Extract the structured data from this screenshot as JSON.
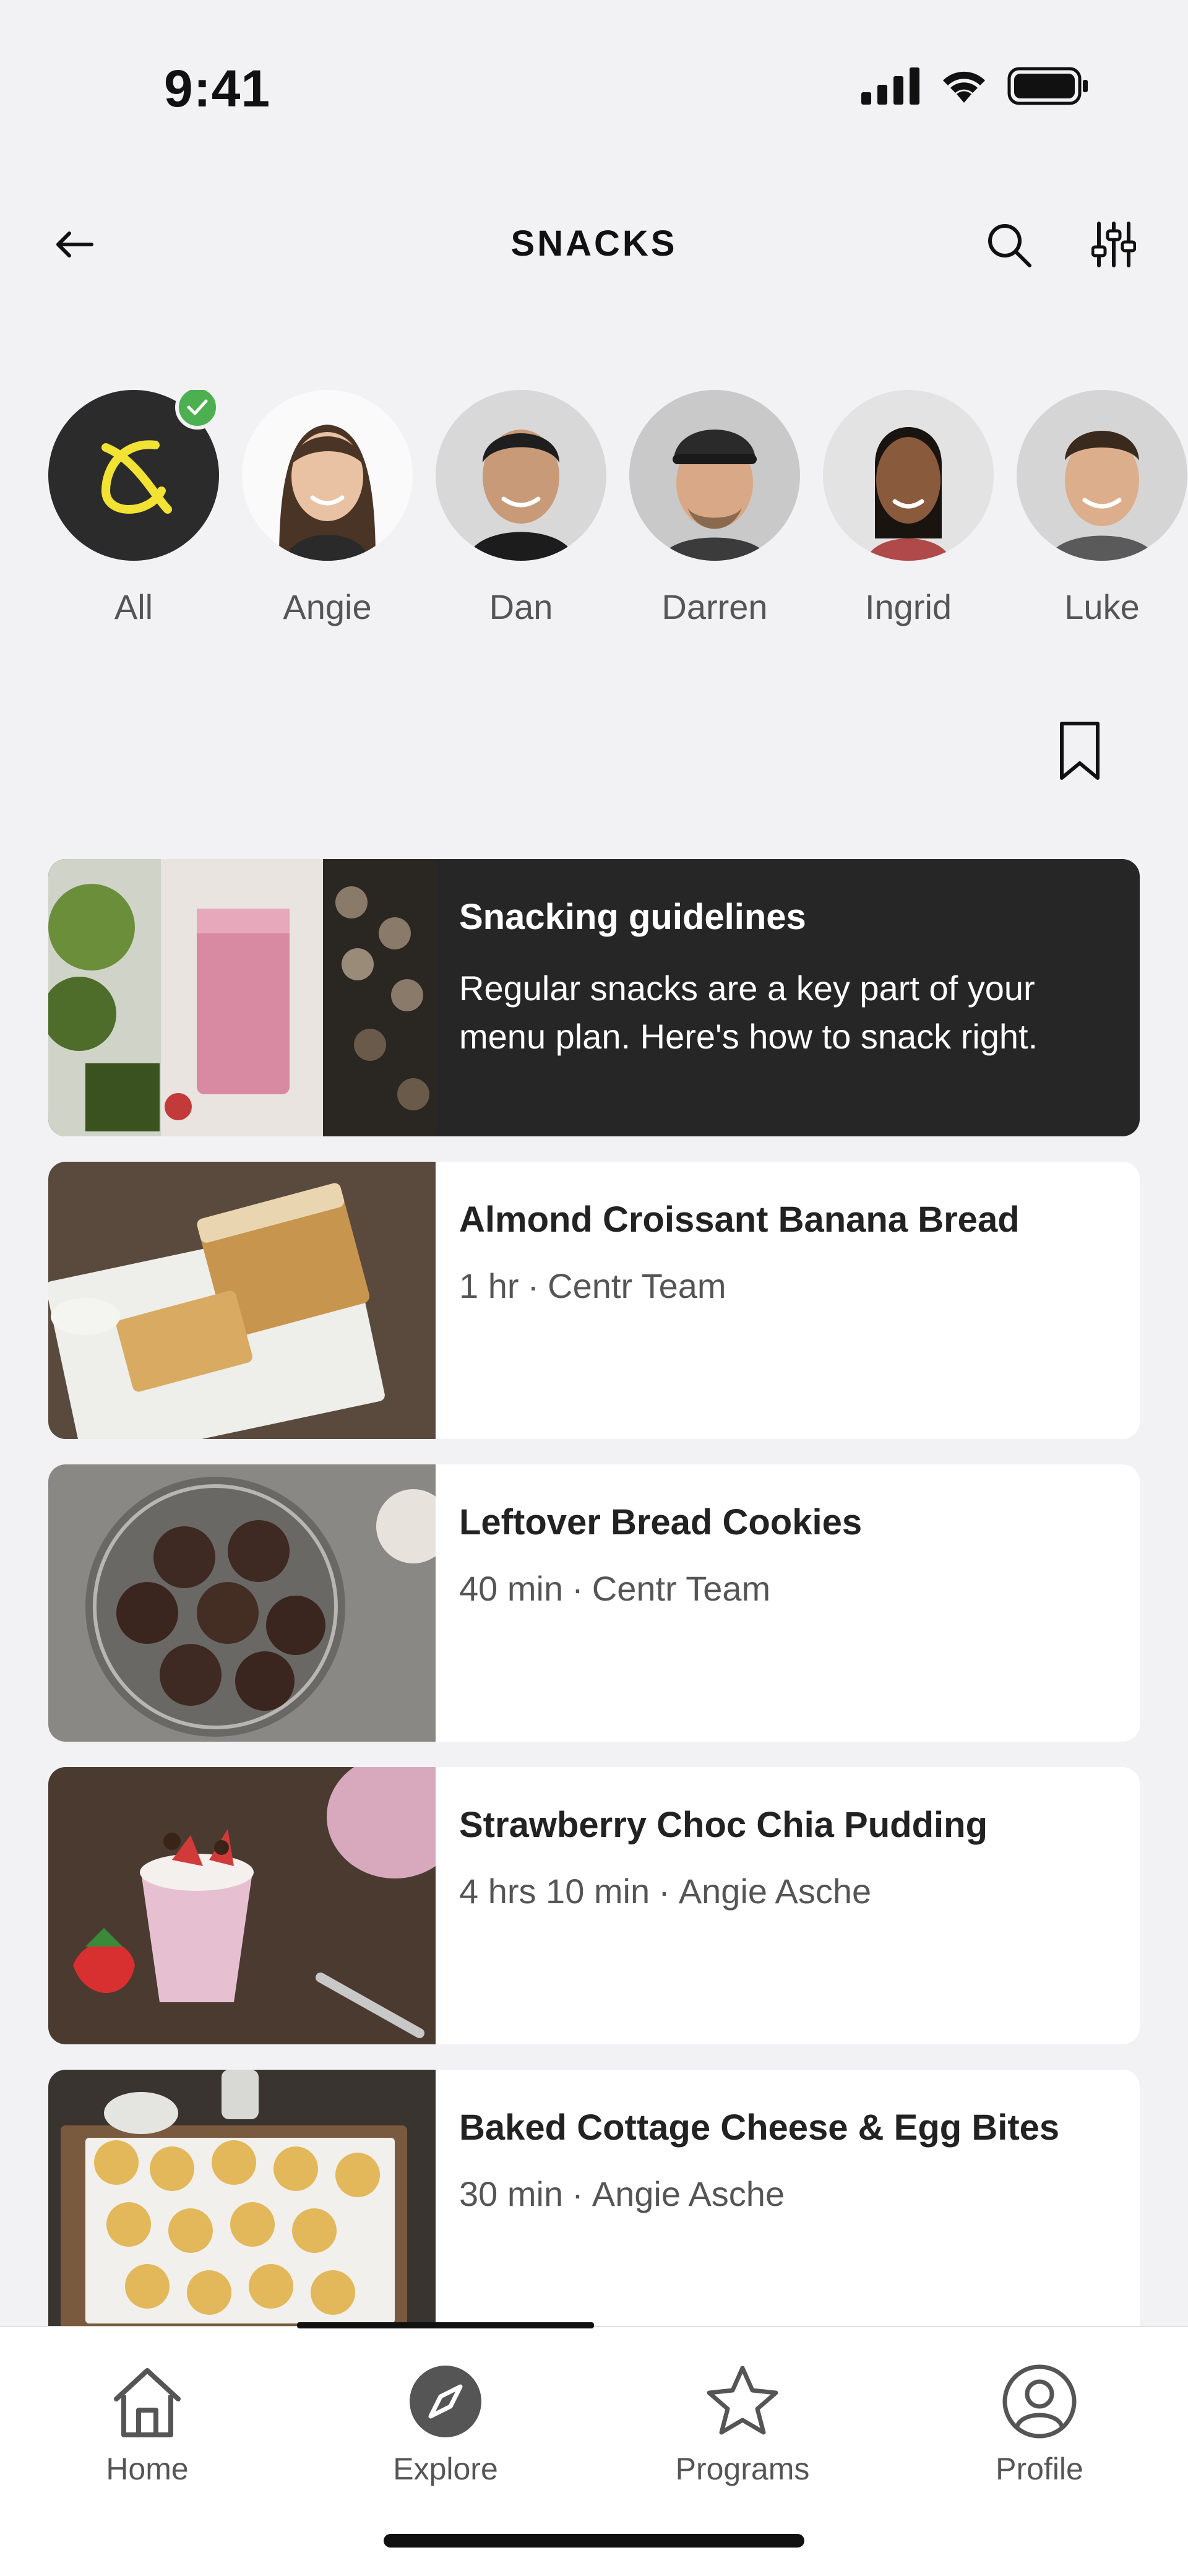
{
  "status_bar": {
    "time": "9:41"
  },
  "header": {
    "title": "SNACKS"
  },
  "trainers": [
    {
      "name": "All",
      "selected": true
    },
    {
      "name": "Angie",
      "selected": false
    },
    {
      "name": "Dan",
      "selected": false
    },
    {
      "name": "Darren",
      "selected": false
    },
    {
      "name": "Ingrid",
      "selected": false
    },
    {
      "name": "Luke",
      "selected": false
    }
  ],
  "guide_card": {
    "title": "Snacking guidelines",
    "description": "Regular snacks are a key part of your menu plan. Here's how to snack right."
  },
  "recipes": [
    {
      "title": "Almond Croissant Banana Bread",
      "duration": "1 hr",
      "author": "Centr Team"
    },
    {
      "title": "Leftover Bread Cookies",
      "duration": "40 min",
      "author": "Centr Team"
    },
    {
      "title": "Strawberry Choc Chia Pudding",
      "duration": "4 hrs 10 min",
      "author": "Angie Asche"
    },
    {
      "title": "Baked Cottage Cheese & Egg Bites",
      "duration": "30 min",
      "author": "Angie Asche"
    }
  ],
  "meta_separator": "·",
  "tabbar": {
    "items": [
      {
        "label": "Home",
        "icon": "home-icon",
        "active": false
      },
      {
        "label": "Explore",
        "icon": "compass-icon",
        "active": true
      },
      {
        "label": "Programs",
        "icon": "star-icon",
        "active": false
      },
      {
        "label": "Profile",
        "icon": "profile-icon",
        "active": false
      }
    ]
  },
  "colors": {
    "background": "#f2f2f4",
    "dark_card": "#262626",
    "brand_yellow": "#f2e233",
    "check_green": "#4caf50",
    "text_primary": "#222222",
    "text_secondary": "#555555"
  }
}
